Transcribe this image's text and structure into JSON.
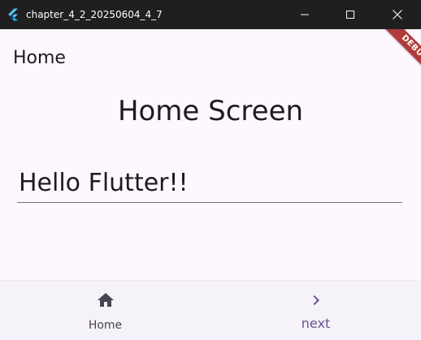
{
  "window": {
    "title": "chapter_4_2_20250604_4_7",
    "icon": "flutter-logo-icon",
    "controls": [
      "minimize-icon",
      "maximize-icon",
      "close-icon"
    ]
  },
  "app": {
    "appbar_title": "Home",
    "debug_banner": "DEBUG",
    "heading": "Home Screen",
    "text_field_value": "Hello Flutter!!"
  },
  "bottom_nav": {
    "items": [
      {
        "label": "Home",
        "icon": "home-icon",
        "selected": false
      },
      {
        "label": "next",
        "icon": "chevron-right-icon",
        "selected": true
      }
    ]
  },
  "colors": {
    "titlebar_bg": "#1f1f1f",
    "app_bg": "#fdf7ff",
    "nav_bg": "#f6f2fa",
    "accent": "#65558f",
    "debug_banner": "#b13b3b"
  }
}
